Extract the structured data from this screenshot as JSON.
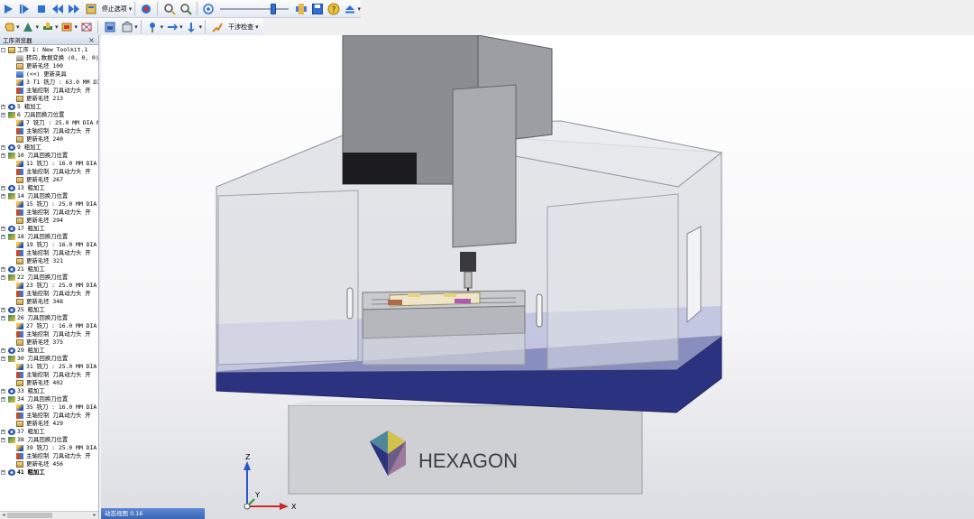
{
  "toolbar_top": {
    "stop_option_label": "停止选项",
    "buttons": [
      "play-icon",
      "step-icon",
      "stop-icon",
      "rewind-icon",
      "fast-forward-icon",
      "book-icon",
      "record-icon",
      "zoom-in-icon",
      "zoom-out-icon",
      "zoom-fit-icon",
      "speed-slider",
      "tool-icon",
      "save-icon",
      "help-icon",
      "eject-icon"
    ],
    "speed_fraction": 0.75
  },
  "toolbar_second": {
    "interference_label": "干涉检查"
  },
  "panel": {
    "title": "工序浏览器",
    "close": "×",
    "tree": [
      {
        "level": 0,
        "exp": "-",
        "icon": "doc",
        "text": "工序 1: New Toolkit.1"
      },
      {
        "level": 1,
        "icon": "rot",
        "text": "转向,数据变换 (0, 0, 0)"
      },
      {
        "level": 1,
        "icon": "stock",
        "text": "更新毛坯 100"
      },
      {
        "level": 1,
        "icon": "fixture",
        "text": "(<<) 更新夹具"
      },
      {
        "level": 1,
        "icon": "tool",
        "text": "3 T1 铣刀 : 63.0 MM DIA"
      },
      {
        "level": 1,
        "icon": "spindle",
        "text": "主轴控制 刀具动力头 开"
      },
      {
        "level": 1,
        "icon": "stock",
        "text": "更新毛坯 213"
      },
      {
        "level": 0,
        "exp": "+",
        "icon": "cycle",
        "text": "5 粗加工"
      },
      {
        "level": 0,
        "exp": "+",
        "icon": "change",
        "text": "6 刀具回换刀位置"
      },
      {
        "level": 1,
        "icon": "tool",
        "text": "7 铣刀 : 25.0 MM DIA MU"
      },
      {
        "level": 1,
        "icon": "spindle",
        "text": "主轴控制 刀具动力头 开"
      },
      {
        "level": 1,
        "icon": "stock",
        "text": "更新毛坯 240"
      },
      {
        "level": 0,
        "exp": "+",
        "icon": "cycle",
        "text": "9 粗加工"
      },
      {
        "level": 0,
        "exp": "+",
        "icon": "change",
        "text": "10 刀具回换刀位置"
      },
      {
        "level": 1,
        "icon": "tool",
        "text": "11 铣刀 : 16.0 MM DIA M"
      },
      {
        "level": 1,
        "icon": "spindle",
        "text": "主轴控制 刀具动力头 开"
      },
      {
        "level": 1,
        "icon": "stock",
        "text": "更新毛坯 267"
      },
      {
        "level": 0,
        "exp": "+",
        "icon": "cycle",
        "text": "13 粗加工"
      },
      {
        "level": 0,
        "exp": "+",
        "icon": "change",
        "text": "14 刀具回换刀位置"
      },
      {
        "level": 1,
        "icon": "tool",
        "text": "15 铣刀 : 25.0 MM DIA M"
      },
      {
        "level": 1,
        "icon": "spindle",
        "text": "主轴控制 刀具动力头 开"
      },
      {
        "level": 1,
        "icon": "stock",
        "text": "更新毛坯 294"
      },
      {
        "level": 0,
        "exp": "+",
        "icon": "cycle",
        "text": "17 粗加工"
      },
      {
        "level": 0,
        "exp": "+",
        "icon": "change",
        "text": "18 刀具回换刀位置"
      },
      {
        "level": 1,
        "icon": "tool",
        "text": "19 铣刀 : 16.0 MM DIA M"
      },
      {
        "level": 1,
        "icon": "spindle",
        "text": "主轴控制 刀具动力头 开"
      },
      {
        "level": 1,
        "icon": "stock",
        "text": "更新毛坯 321"
      },
      {
        "level": 0,
        "exp": "+",
        "icon": "cycle",
        "text": "21 粗加工"
      },
      {
        "level": 0,
        "exp": "+",
        "icon": "change",
        "text": "22 刀具回换刀位置"
      },
      {
        "level": 1,
        "icon": "tool",
        "text": "23 铣刀 : 25.0 MM DIA M"
      },
      {
        "level": 1,
        "icon": "spindle",
        "text": "主轴控制 刀具动力头 开"
      },
      {
        "level": 1,
        "icon": "stock",
        "text": "更新毛坯 348"
      },
      {
        "level": 0,
        "exp": "+",
        "icon": "cycle",
        "text": "25 粗加工"
      },
      {
        "level": 0,
        "exp": "+",
        "icon": "change",
        "text": "26 刀具回换刀位置"
      },
      {
        "level": 1,
        "icon": "tool",
        "text": "27 铣刀 : 16.0 MM DIA M"
      },
      {
        "level": 1,
        "icon": "spindle",
        "text": "主轴控制 刀具动力头 开"
      },
      {
        "level": 1,
        "icon": "stock",
        "text": "更新毛坯 375"
      },
      {
        "level": 0,
        "exp": "+",
        "icon": "cycle",
        "text": "29 粗加工"
      },
      {
        "level": 0,
        "exp": "+",
        "icon": "change",
        "text": "30 刀具回换刀位置"
      },
      {
        "level": 1,
        "icon": "tool",
        "text": "31 铣刀 : 25.0 MM DIA M"
      },
      {
        "level": 1,
        "icon": "spindle",
        "text": "主轴控制 刀具动力头 开"
      },
      {
        "level": 1,
        "icon": "stock",
        "text": "更新毛坯 402"
      },
      {
        "level": 0,
        "exp": "+",
        "icon": "cycle",
        "text": "33 粗加工"
      },
      {
        "level": 0,
        "exp": "+",
        "icon": "change",
        "text": "34 刀具回换刀位置"
      },
      {
        "level": 1,
        "icon": "tool",
        "text": "35 铣刀 : 16.0 MM DIA M"
      },
      {
        "level": 1,
        "icon": "spindle",
        "text": "主轴控制 刀具动力头 开"
      },
      {
        "level": 1,
        "icon": "stock",
        "text": "更新毛坯 429"
      },
      {
        "level": 0,
        "exp": "+",
        "icon": "cycle",
        "text": "37 粗加工"
      },
      {
        "level": 0,
        "exp": "+",
        "icon": "change",
        "text": "38 刀具回换刀位置"
      },
      {
        "level": 1,
        "icon": "tool",
        "text": "39 铣刀 : 25.0 MM DIA M"
      },
      {
        "level": 1,
        "icon": "spindle",
        "text": "主轴控制 刀具动力头 开"
      },
      {
        "level": 1,
        "icon": "stock",
        "text": "更新毛坯 456"
      },
      {
        "level": 0,
        "exp": "+",
        "icon": "cycle",
        "text": "41 粗加工",
        "bold": true
      }
    ]
  },
  "viewport": {
    "brand": "HEXAGON",
    "axis_z": "Z",
    "axis_y": "Y",
    "axis_x": "X",
    "base_color": "#2b3380"
  },
  "status": {
    "text": "动态视图 0.16"
  }
}
